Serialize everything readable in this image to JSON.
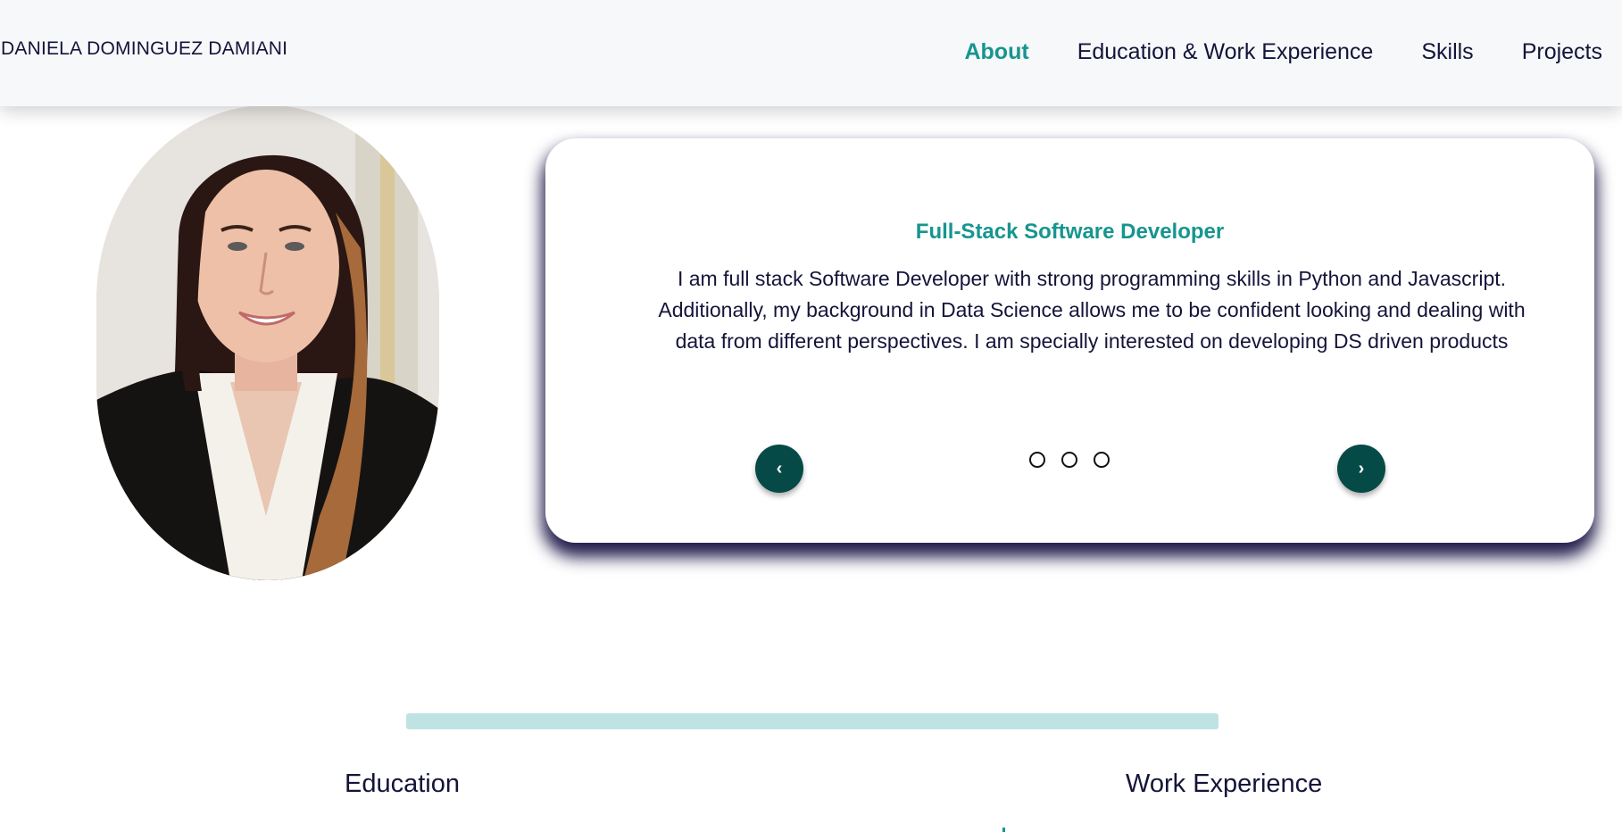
{
  "header": {
    "brand": "DANIELA DOMINGUEZ DAMIANI",
    "nav": [
      {
        "label": "About",
        "active": true
      },
      {
        "label": "Education & Work Experience",
        "active": false
      },
      {
        "label": "Skills",
        "active": false
      },
      {
        "label": "Projects",
        "active": false
      }
    ]
  },
  "hero": {
    "card": {
      "title": "Full-Stack Software Developer",
      "text": "I am full stack Software Developer with strong programming skills in Python and Javascript. Additionally, my background in Data Science allows me to be confident looking and dealing with data from different perspectives. I am specially interested on developing DS driven products",
      "prev_icon": "‹",
      "next_icon": "›",
      "dots": 3
    }
  },
  "sections": {
    "education_heading": "Education",
    "work_heading": "Work Experience"
  },
  "colors": {
    "accent": "#17958f",
    "dark_teal": "#064a47",
    "text": "#14143a",
    "nav_bg": "#f7f8fa",
    "progress_track": "#bfe3e2"
  }
}
